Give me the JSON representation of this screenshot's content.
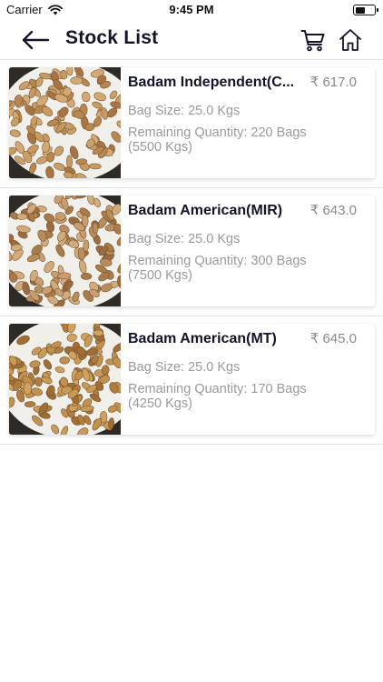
{
  "status_bar": {
    "carrier": "Carrier",
    "time": "9:45 PM"
  },
  "nav": {
    "title": "Stock List"
  },
  "items": [
    {
      "name": "Badam Independent(C...",
      "price": "₹ 617.0",
      "bag_size": "Bag Size: 25.0 Kgs",
      "remaining": "Remaining Quantity: 220 Bags (5500 Kgs)"
    },
    {
      "name": "Badam American(MIR)",
      "price": "₹ 643.0",
      "bag_size": "Bag Size: 25.0 Kgs",
      "remaining": "Remaining Quantity: 300 Bags (7500 Kgs)"
    },
    {
      "name": "Badam American(MT)",
      "price": "₹ 645.0",
      "bag_size": "Bag Size: 25.0 Kgs",
      "remaining": "Remaining Quantity: 170 Bags (4250 Kgs)"
    }
  ],
  "colors": {
    "title": "#14142a",
    "muted": "#9a9a9e",
    "divider": "#e4e4e8",
    "almond": "#c79a62"
  }
}
